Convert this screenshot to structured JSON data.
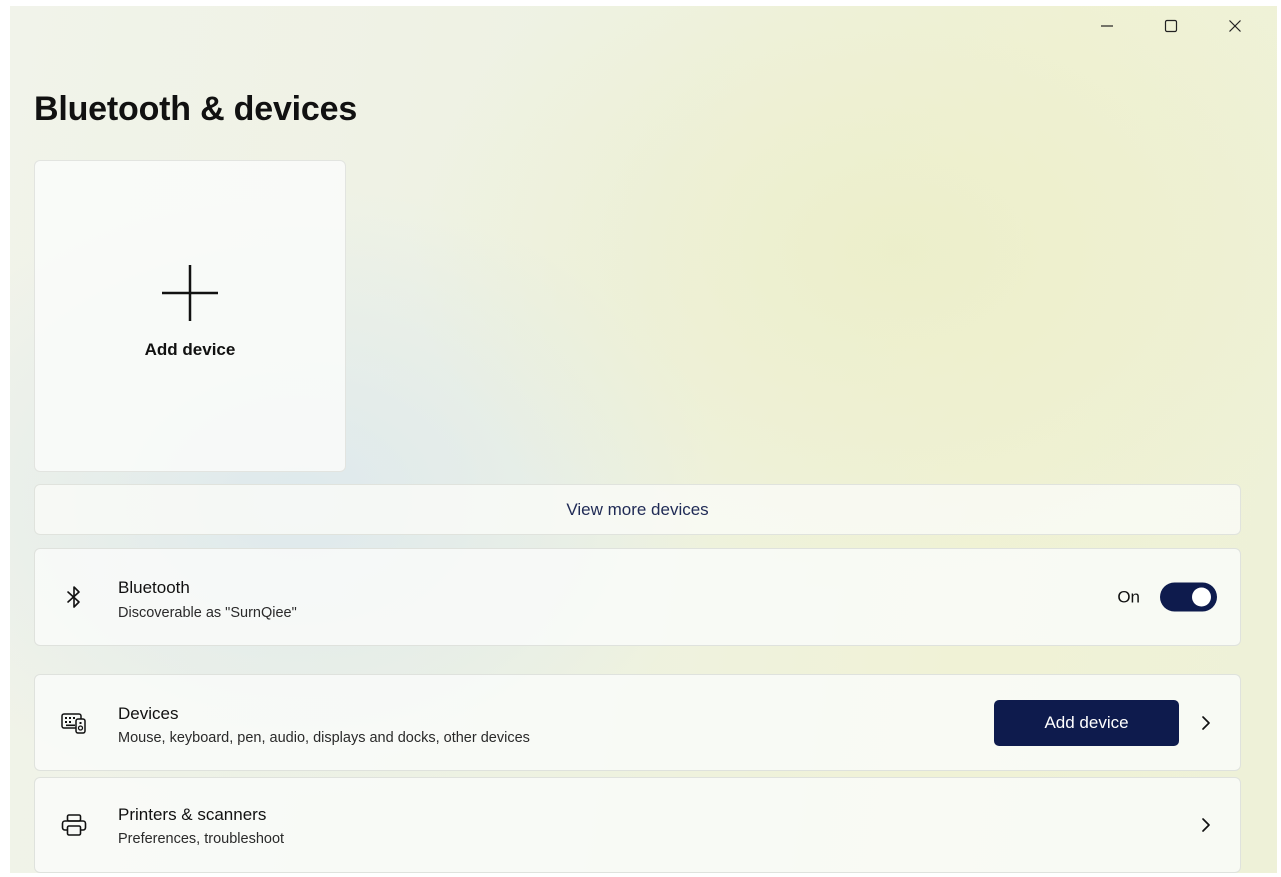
{
  "window": {
    "controls": {
      "minimize_icon": "minimize-icon",
      "maximize_icon": "maximize-icon",
      "close_icon": "close-icon"
    }
  },
  "page": {
    "title": "Bluetooth & devices"
  },
  "add_tile": {
    "label": "Add device",
    "icon": "plus-icon"
  },
  "view_more": {
    "label": "View more devices"
  },
  "bluetooth": {
    "icon": "bluetooth-icon",
    "title": "Bluetooth",
    "subtitle": "Discoverable as \"SurnQiee\"",
    "toggle_state_label": "On",
    "toggle_on": true
  },
  "devices": {
    "icon": "keyboard-device-icon",
    "title": "Devices",
    "subtitle": "Mouse, keyboard, pen, audio, displays and docks, other devices",
    "button_label": "Add device"
  },
  "printers": {
    "icon": "printer-icon",
    "title": "Printers & scanners",
    "subtitle": "Preferences, troubleshoot"
  },
  "colors": {
    "accent": "#0e1b4d",
    "link_text": "#1f2a55"
  }
}
